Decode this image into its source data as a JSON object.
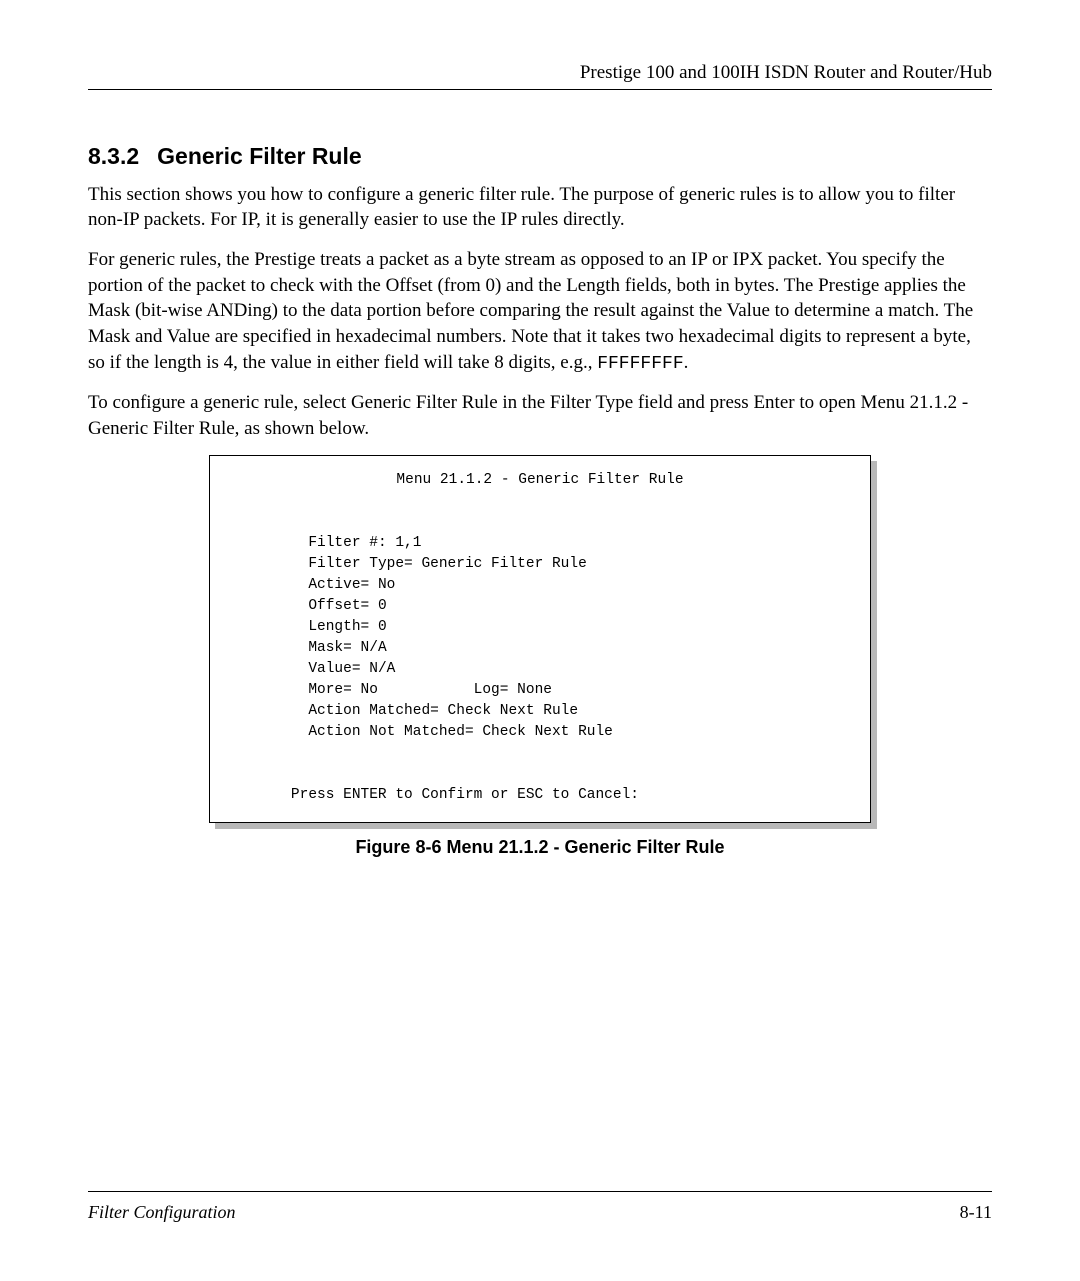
{
  "header": {
    "running_head": "Prestige 100 and 100IH ISDN Router and Router/Hub"
  },
  "section": {
    "number": "8.3.2",
    "title": "Generic Filter Rule"
  },
  "paragraphs": {
    "p1": "This section shows you how to configure a generic filter rule.  The purpose of generic rules is to allow you to filter non-IP packets.  For IP, it is generally easier to use the IP rules directly.",
    "p2_before": "For generic rules, the Prestige treats a packet as a byte stream as opposed to an IP or IPX packet.  You specify the portion of the packet to check with the Offset (from 0) and the Length fields, both in bytes.  The Prestige applies the Mask (bit-wise ANDing) to the data portion before comparing the result against the Value to determine a match.  The Mask and Value are specified in hexadecimal numbers.  Note that it takes two hexadecimal digits to represent a byte, so if the length is 4, the value in either field will take 8 digits, e.g., ",
    "p2_mono": "FFFFFFFF",
    "p2_after": ".",
    "p3": "To configure a generic rule, select Generic Filter Rule in the Filter Type field and press Enter to open Menu 21.1.2 - Generic Filter Rule, as shown below."
  },
  "figure": {
    "menu_title": "Menu 21.1.2 - Generic Filter Rule",
    "lines": {
      "filter_no": "Filter #: 1,1",
      "filter_type": "Filter Type= Generic Filter Rule",
      "active": "Active= No",
      "offset": "Offset= 0",
      "length": "Length= 0",
      "mask": "Mask= N/A",
      "value": "Value= N/A",
      "more_log": "More= No           Log= None",
      "action_matched": "Action Matched= Check Next Rule",
      "action_not_matched": "Action Not Matched= Check Next Rule"
    },
    "prompt": "Press ENTER to Confirm or ESC to Cancel:",
    "caption": "Figure 8-6 Menu 21.1.2 - Generic Filter Rule"
  },
  "footer": {
    "left": "Filter Configuration",
    "right": "8-11"
  }
}
